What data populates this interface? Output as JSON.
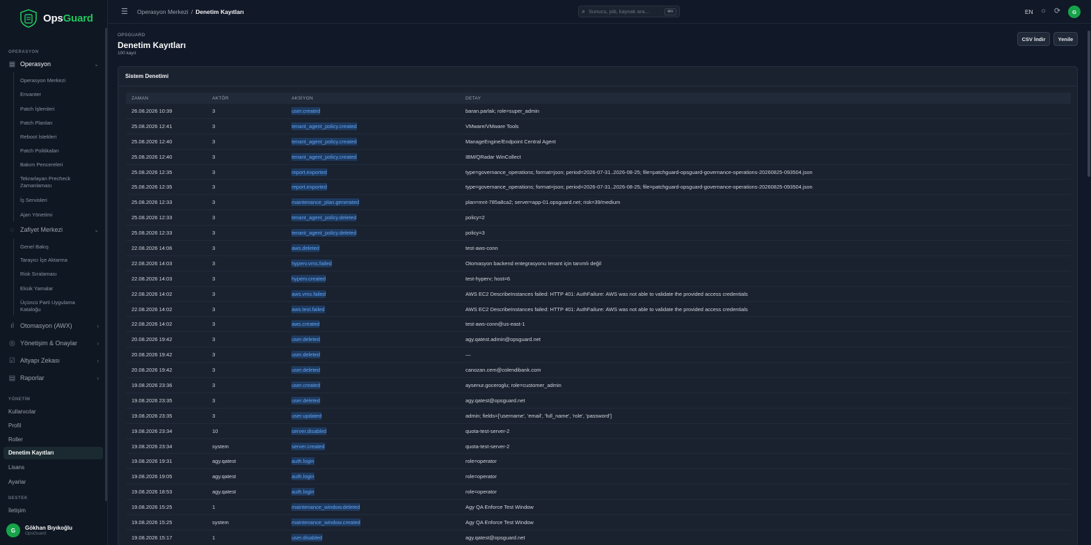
{
  "brand": {
    "part1": "Ops",
    "part2": "Guard"
  },
  "sidebar": {
    "sections": {
      "operasyon": "OPERASYON",
      "yonetim": "YÖNETİM",
      "destek": "DESTEK"
    },
    "operasyon_group": "Operasyon",
    "operasyon_items": [
      "Operasyon Merkezi",
      "Envanter",
      "Patch İşlemleri",
      "Patch Planları",
      "Reboot İstekleri",
      "Patch Politikaları",
      "Bakım Pencereleri",
      "Tekrarlayan Precheck Zamanlaması",
      "İş Servisleri",
      "Ajan Yönetimi"
    ],
    "zafiyet_group": "Zafiyet Merkezi",
    "zafiyet_items": [
      "Genel Bakış",
      "Tarayıcı İçe Aktarma",
      "Risk Sıralaması",
      "Eksik Yamalar",
      "Üçüncü Parti Uygulama Kataloğu"
    ],
    "other_groups": [
      "Otomasyon (AWX)",
      "Yönetişim & Onaylar",
      "Altyapı Zekası",
      "Raporlar"
    ],
    "yonetim_items": [
      "Kullanıcılar",
      "Profil",
      "Roller",
      "Denetim Kayıtları",
      "Lisans",
      "Ayarlar"
    ],
    "destek_items": [
      "İletişim"
    ],
    "user": {
      "initial": "G",
      "name": "Gökhan Bıyıkoğlu",
      "org": "OpsGuard"
    }
  },
  "topbar": {
    "breadcrumb_parent": "Operasyon Merkezi",
    "breadcrumb_sep": "/",
    "breadcrumb_current": "Denetim Kayıtları",
    "search_placeholder": "Sunucu, job, kaynak ara...",
    "search_shortcut": "⌘K",
    "lang": "EN",
    "avatar_initial": "G"
  },
  "header": {
    "eyebrow": "OPSGUARD",
    "title": "Denetim Kayıtları",
    "count": "100 kayıt",
    "csv_button": "CSV İndir",
    "refresh_button": "Yenile"
  },
  "card": {
    "title": "Sistem Denetimi"
  },
  "table": {
    "headers": [
      "ZAMAN",
      "AKTÖR",
      "AKSİYON",
      "DETAY"
    ],
    "rows": [
      [
        "26.08.2026 10:39",
        "3",
        "user.created",
        "baran.parlak; role=super_admin"
      ],
      [
        "25.08.2026 12:41",
        "3",
        "tenant_agent_policy.created",
        "VMware/VMware Tools"
      ],
      [
        "25.08.2026 12:40",
        "3",
        "tenant_agent_policy.created",
        "ManageEngine/Endpoint Central Agent"
      ],
      [
        "25.08.2026 12:40",
        "3",
        "tenant_agent_policy.created",
        "IBM/QRadar WinCollect"
      ],
      [
        "25.08.2026 12:35",
        "3",
        "report.exported",
        "type=governance_operations; format=json; period=2026-07-31..2026-08-25; file=patchguard-opsguard-governance-operations-20260825-093504.json"
      ],
      [
        "25.08.2026 12:35",
        "3",
        "report.exported",
        "type=governance_operations; format=json; period=2026-07-31..2026-08-25; file=patchguard-opsguard-governance-operations-20260825-093504.json"
      ],
      [
        "25.08.2026 12:33",
        "3",
        "maintenance_plan.generated",
        "plan=mnt-785a8ca2; server=app-01.opsguard.net; risk=39/medium"
      ],
      [
        "25.08.2026 12:33",
        "3",
        "tenant_agent_policy.deleted",
        "policy=2"
      ],
      [
        "25.08.2026 12:33",
        "3",
        "tenant_agent_policy.deleted",
        "policy=3"
      ],
      [
        "22.08.2026 14:06",
        "3",
        "aws.deleted",
        "test-aws-conn"
      ],
      [
        "22.08.2026 14:03",
        "3",
        "hyperv.vms.failed",
        "Otomasyon backend entegrasyonu tenant için tanımlı değil"
      ],
      [
        "22.08.2026 14:03",
        "3",
        "hyperv.created",
        "test-hyperv; host=6"
      ],
      [
        "22.08.2026 14:02",
        "3",
        "aws.vms.failed",
        "AWS EC2 DescribeInstances failed: HTTP 401: AuthFailure: AWS was not able to validate the provided access credentials"
      ],
      [
        "22.08.2026 14:02",
        "3",
        "aws.test.failed",
        "AWS EC2 DescribeInstances failed: HTTP 401: AuthFailure: AWS was not able to validate the provided access credentials"
      ],
      [
        "22.08.2026 14:02",
        "3",
        "aws.created",
        "test-aws-conn@us-east-1"
      ],
      [
        "20.08.2026 19:42",
        "3",
        "user.deleted",
        "agy.qatest.admin@opsguard.net"
      ],
      [
        "20.08.2026 19:42",
        "3",
        "user.deleted",
        "—"
      ],
      [
        "20.08.2026 19:42",
        "3",
        "user.deleted",
        "canozan.cem@colendibank.com"
      ],
      [
        "19.08.2026 23:36",
        "3",
        "user.created",
        "aysenur.goceroglu; role=customer_admin"
      ],
      [
        "19.08.2026 23:35",
        "3",
        "user.deleted",
        "agy.qatest@opsguard.net"
      ],
      [
        "19.08.2026 23:35",
        "3",
        "user.updated",
        "admin; fields=['username', 'email', 'full_name', 'role', 'password']"
      ],
      [
        "19.08.2026 23:34",
        "10",
        "server.disabled",
        "quota-test-server-2"
      ],
      [
        "19.08.2026 23:34",
        "system",
        "server.created",
        "quota-test-server-2"
      ],
      [
        "19.08.2026 19:31",
        "agy.qatest",
        "auth.login",
        "role=operator"
      ],
      [
        "19.08.2026 19:05",
        "agy.qatest",
        "auth.login",
        "role=operator"
      ],
      [
        "19.08.2026 18:53",
        "agy.qatest",
        "auth.login",
        "role=operator"
      ],
      [
        "19.08.2026 15:25",
        "1",
        "maintenance_window.deleted",
        "Agy QA Enforce Test Window"
      ],
      [
        "19.08.2026 15:25",
        "system",
        "maintenance_window.created",
        "Agy QA Enforce Test Window"
      ],
      [
        "19.08.2026 15:17",
        "1",
        "user.disabled",
        "agy.qatest@opsguard.net"
      ]
    ]
  }
}
